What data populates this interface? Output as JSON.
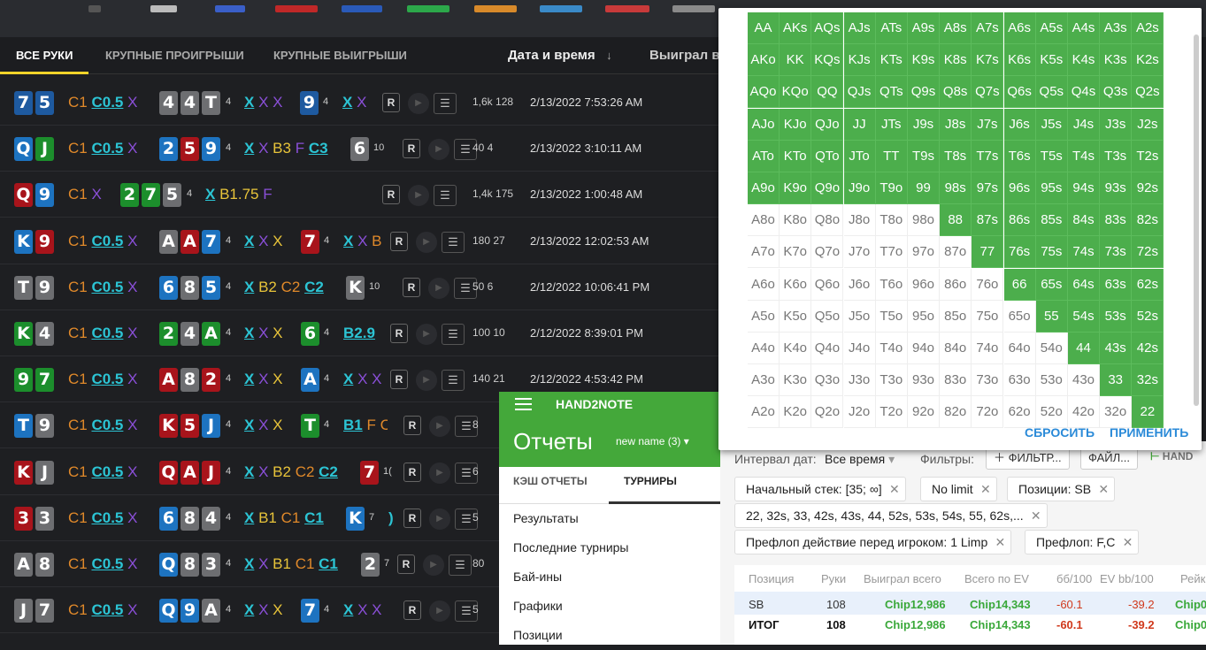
{
  "tabs": {
    "all": "ВСЕ РУКИ",
    "big_losses": "КРУПНЫЕ ПРОИГРЫШИ",
    "big_wins": "КРУПНЫЕ ВЫИГРЫШИ",
    "date_col": "Дата и время",
    "sort_arrow": "↓",
    "won_col": "Выиграл в"
  },
  "rows": [
    {
      "cards": [
        "7",
        "5"
      ],
      "colors": [
        "s",
        "s"
      ],
      "pre": [
        "C1",
        "C0.5",
        "X"
      ],
      "flop": [
        "4",
        "4",
        "T"
      ],
      "fc": [
        "n",
        "n",
        "n"
      ],
      "flop_actions": [
        "X",
        "X",
        "X"
      ],
      "turn": "9",
      "tc": "s",
      "turn_actions": [
        "X",
        "X"
      ],
      "stat": "1,6k 128",
      "dt": "2/13/2022 7:53:26 AM"
    },
    {
      "cards": [
        "Q",
        "J"
      ],
      "colors": [
        "d",
        "cl"
      ],
      "pre": [
        "C1",
        "C0.5",
        "X"
      ],
      "flop": [
        "2",
        "5",
        "9"
      ],
      "fc": [
        "d",
        "h",
        "d"
      ],
      "flop_actions": [
        "X",
        "X",
        "B3",
        "F",
        "C3"
      ],
      "turn": "6",
      "tc": "n",
      "turn_cnt": "10",
      "stat": "40 4",
      "dt": "2/13/2022 3:10:11 AM"
    },
    {
      "cards": [
        "Q",
        "9"
      ],
      "colors": [
        "h",
        "d"
      ],
      "pre": [
        "C1",
        "X"
      ],
      "flop": [
        "2",
        "7",
        "5"
      ],
      "fc": [
        "cl",
        "cl",
        "n"
      ],
      "flop_actions": [
        "X",
        "B1.75",
        "F"
      ],
      "stat": "1,4k 175",
      "dt": "2/13/2022 1:00:48 AM"
    },
    {
      "cards": [
        "K",
        "9"
      ],
      "colors": [
        "d",
        "h"
      ],
      "pre": [
        "C1",
        "C0.5",
        "X"
      ],
      "flop": [
        "A",
        "A",
        "7"
      ],
      "fc": [
        "n",
        "h",
        "d"
      ],
      "flop_actions": [
        "X",
        "X",
        "X"
      ],
      "turn": "7",
      "tc": "h",
      "turn_actions": [
        "X",
        "X",
        "B"
      ],
      "stat": "180 27",
      "dt": "2/13/2022 12:02:53 AM"
    },
    {
      "cards": [
        "T",
        "9"
      ],
      "colors": [
        "n",
        "n"
      ],
      "pre": [
        "C1",
        "C0.5",
        "X"
      ],
      "flop": [
        "6",
        "8",
        "5"
      ],
      "fc": [
        "d",
        "n",
        "d"
      ],
      "flop_actions": [
        "X",
        "B2",
        "C2",
        "C2"
      ],
      "turn": "K",
      "tc": "n",
      "turn_cnt": "10",
      "stat": "50 6",
      "dt": "2/12/2022 10:06:41 PM"
    },
    {
      "cards": [
        "K",
        "4"
      ],
      "colors": [
        "cl",
        "n"
      ],
      "pre": [
        "C1",
        "C0.5",
        "X"
      ],
      "flop": [
        "2",
        "4",
        "A"
      ],
      "fc": [
        "cl",
        "n",
        "cl"
      ],
      "flop_actions": [
        "X",
        "X",
        "X"
      ],
      "turn": "6",
      "tc": "cl",
      "turn_actions": [
        "B2.9"
      ],
      "stat": "100 10",
      "dt": "2/12/2022 8:39:01 PM"
    },
    {
      "cards": [
        "9",
        "7"
      ],
      "colors": [
        "cl",
        "cl"
      ],
      "pre": [
        "C1",
        "C0.5",
        "X"
      ],
      "flop": [
        "A",
        "8",
        "2"
      ],
      "fc": [
        "h",
        "n",
        "h"
      ],
      "flop_actions": [
        "X",
        "X",
        "X"
      ],
      "turn": "A",
      "tc": "d",
      "turn_actions": [
        "X",
        "X",
        "X"
      ],
      "stat": "140 21",
      "dt": "2/12/2022 4:53:42 PM"
    },
    {
      "cards": [
        "T",
        "9"
      ],
      "colors": [
        "d",
        "n"
      ],
      "pre": [
        "C1",
        "C0.5",
        "X"
      ],
      "flop": [
        "K",
        "5",
        "J"
      ],
      "fc": [
        "h",
        "h",
        "d"
      ],
      "flop_actions": [
        "X",
        "X",
        "X"
      ],
      "turn": "T",
      "tc": "cl",
      "turn_actions": [
        "B1",
        "F",
        "C"
      ],
      "stat": "8",
      "dt": ""
    },
    {
      "cards": [
        "K",
        "J"
      ],
      "colors": [
        "h",
        "n"
      ],
      "pre": [
        "C1",
        "C0.5",
        "X"
      ],
      "flop": [
        "Q",
        "A",
        "J"
      ],
      "fc": [
        "h",
        "h",
        "h"
      ],
      "flop_actions": [
        "X",
        "X",
        "B2",
        "C2",
        "C2"
      ],
      "turn": "7",
      "tc": "h",
      "turn_cnt": "1(",
      "stat": "6",
      "dt": ""
    },
    {
      "cards": [
        "3",
        "3"
      ],
      "colors": [
        "h",
        "n"
      ],
      "pre": [
        "C1",
        "C0.5",
        "X"
      ],
      "flop": [
        "6",
        "8",
        "4"
      ],
      "fc": [
        "d",
        "n",
        "n"
      ],
      "flop_actions": [
        "X",
        "B1",
        "C1",
        "C1"
      ],
      "turn": "K",
      "tc": "d",
      "turn_cnt": "7",
      "turn_actions": [
        ")"
      ],
      "stat": "5",
      "dt": ""
    },
    {
      "cards": [
        "A",
        "8"
      ],
      "colors": [
        "n",
        "n"
      ],
      "pre": [
        "C1",
        "C0.5",
        "X"
      ],
      "flop": [
        "Q",
        "8",
        "3"
      ],
      "fc": [
        "d",
        "n",
        "n"
      ],
      "flop_actions": [
        "X",
        "X",
        "B1",
        "C1",
        "C1"
      ],
      "turn": "2",
      "tc": "n",
      "turn_cnt": "7",
      "stat": "80",
      "dt": ""
    },
    {
      "cards": [
        "J",
        "7"
      ],
      "colors": [
        "n",
        "n"
      ],
      "pre": [
        "C1",
        "C0.5",
        "X"
      ],
      "flop": [
        "Q",
        "9",
        "A"
      ],
      "fc": [
        "d",
        "d",
        "n"
      ],
      "flop_actions": [
        "X",
        "X",
        "X"
      ],
      "turn": "7",
      "tc": "d",
      "turn_actions": [
        "X",
        "X",
        "X"
      ],
      "stat": "5",
      "dt": ""
    }
  ],
  "flop_cnt": "4",
  "btn_r": "R",
  "range": {
    "hands": [
      [
        "AA",
        "AKs",
        "AQs",
        "AJs",
        "ATs",
        "A9s",
        "A8s",
        "A7s",
        "A6s",
        "A5s",
        "A4s",
        "A3s",
        "A2s"
      ],
      [
        "AKo",
        "KK",
        "KQs",
        "KJs",
        "KTs",
        "K9s",
        "K8s",
        "K7s",
        "K6s",
        "K5s",
        "K4s",
        "K3s",
        "K2s"
      ],
      [
        "AQo",
        "KQo",
        "QQ",
        "QJs",
        "QTs",
        "Q9s",
        "Q8s",
        "Q7s",
        "Q6s",
        "Q5s",
        "Q4s",
        "Q3s",
        "Q2s"
      ],
      [
        "AJo",
        "KJo",
        "QJo",
        "JJ",
        "JTs",
        "J9s",
        "J8s",
        "J7s",
        "J6s",
        "J5s",
        "J4s",
        "J3s",
        "J2s"
      ],
      [
        "ATo",
        "KTo",
        "QTo",
        "JTo",
        "TT",
        "T9s",
        "T8s",
        "T7s",
        "T6s",
        "T5s",
        "T4s",
        "T3s",
        "T2s"
      ],
      [
        "A9o",
        "K9o",
        "Q9o",
        "J9o",
        "T9o",
        "99",
        "98s",
        "97s",
        "96s",
        "95s",
        "94s",
        "93s",
        "92s"
      ],
      [
        "A8o",
        "K8o",
        "Q8o",
        "J8o",
        "T8o",
        "98o",
        "88",
        "87s",
        "86s",
        "85s",
        "84s",
        "83s",
        "82s"
      ],
      [
        "A7o",
        "K7o",
        "Q7o",
        "J7o",
        "T7o",
        "97o",
        "87o",
        "77",
        "76s",
        "75s",
        "74s",
        "73s",
        "72s"
      ],
      [
        "A6o",
        "K6o",
        "Q6o",
        "J6o",
        "T6o",
        "96o",
        "86o",
        "76o",
        "66",
        "65s",
        "64s",
        "63s",
        "62s"
      ],
      [
        "A5o",
        "K5o",
        "Q5o",
        "J5o",
        "T5o",
        "95o",
        "85o",
        "75o",
        "65o",
        "55",
        "54s",
        "53s",
        "52s"
      ],
      [
        "A4o",
        "K4o",
        "Q4o",
        "J4o",
        "T4o",
        "94o",
        "84o",
        "74o",
        "64o",
        "54o",
        "44",
        "43s",
        "42s"
      ],
      [
        "A3o",
        "K3o",
        "Q3o",
        "J3o",
        "T3o",
        "93o",
        "83o",
        "73o",
        "63o",
        "53o",
        "43o",
        "33",
        "32s"
      ],
      [
        "A2o",
        "K2o",
        "Q2o",
        "J2o",
        "T2o",
        "92o",
        "82o",
        "72o",
        "62o",
        "52o",
        "42o",
        "32o",
        "22"
      ]
    ],
    "selected_from_col": [
      0,
      0,
      0,
      0,
      0,
      0,
      6,
      7,
      8,
      9,
      10,
      11,
      12
    ],
    "reset": "СБРОСИТЬ",
    "apply": "ПРИМЕНИТЬ"
  },
  "h2n": {
    "app_name": "HAND2NOTE",
    "title": "Отчеты",
    "report_name": "new name (3)",
    "tab_cache": "КЭШ ОТЧЕТЫ",
    "tab_tournaments": "ТУРНИРЫ",
    "menu": [
      "Результаты",
      "Последние турниры",
      "Бай-ины",
      "Графики",
      "Позиции"
    ]
  },
  "report": {
    "interval_label": "Интервал дат:",
    "interval_value": "Все время",
    "filters_label": "Фильтры:",
    "filter_btn": "ФИЛЬТР...",
    "file_btn": "ФАЙЛ...",
    "brand": "HAND",
    "chips": [
      "Начальный стек: [35; ∞]",
      "No limit",
      "Позиции: SB",
      "22, 32s, 33, 42s, 43s, 44, 52s, 53s, 54s, 55, 62s,...",
      "Префлоп действие перед игроком: 1 Limp",
      "Префлоп: F,C"
    ],
    "headers": [
      "Позиция",
      "Руки",
      "Выиграл всего",
      "Всего по EV",
      "бб/100",
      "EV bb/100",
      "Рейк"
    ],
    "rows": [
      [
        "SB",
        "108",
        "Chip12,986",
        "Chip14,343",
        "-60.1",
        "-39.2",
        "Chip0"
      ],
      [
        "ИТОГ",
        "108",
        "Chip12,986",
        "Chip14,343",
        "-60.1",
        "-39.2",
        "Chip0"
      ]
    ]
  }
}
